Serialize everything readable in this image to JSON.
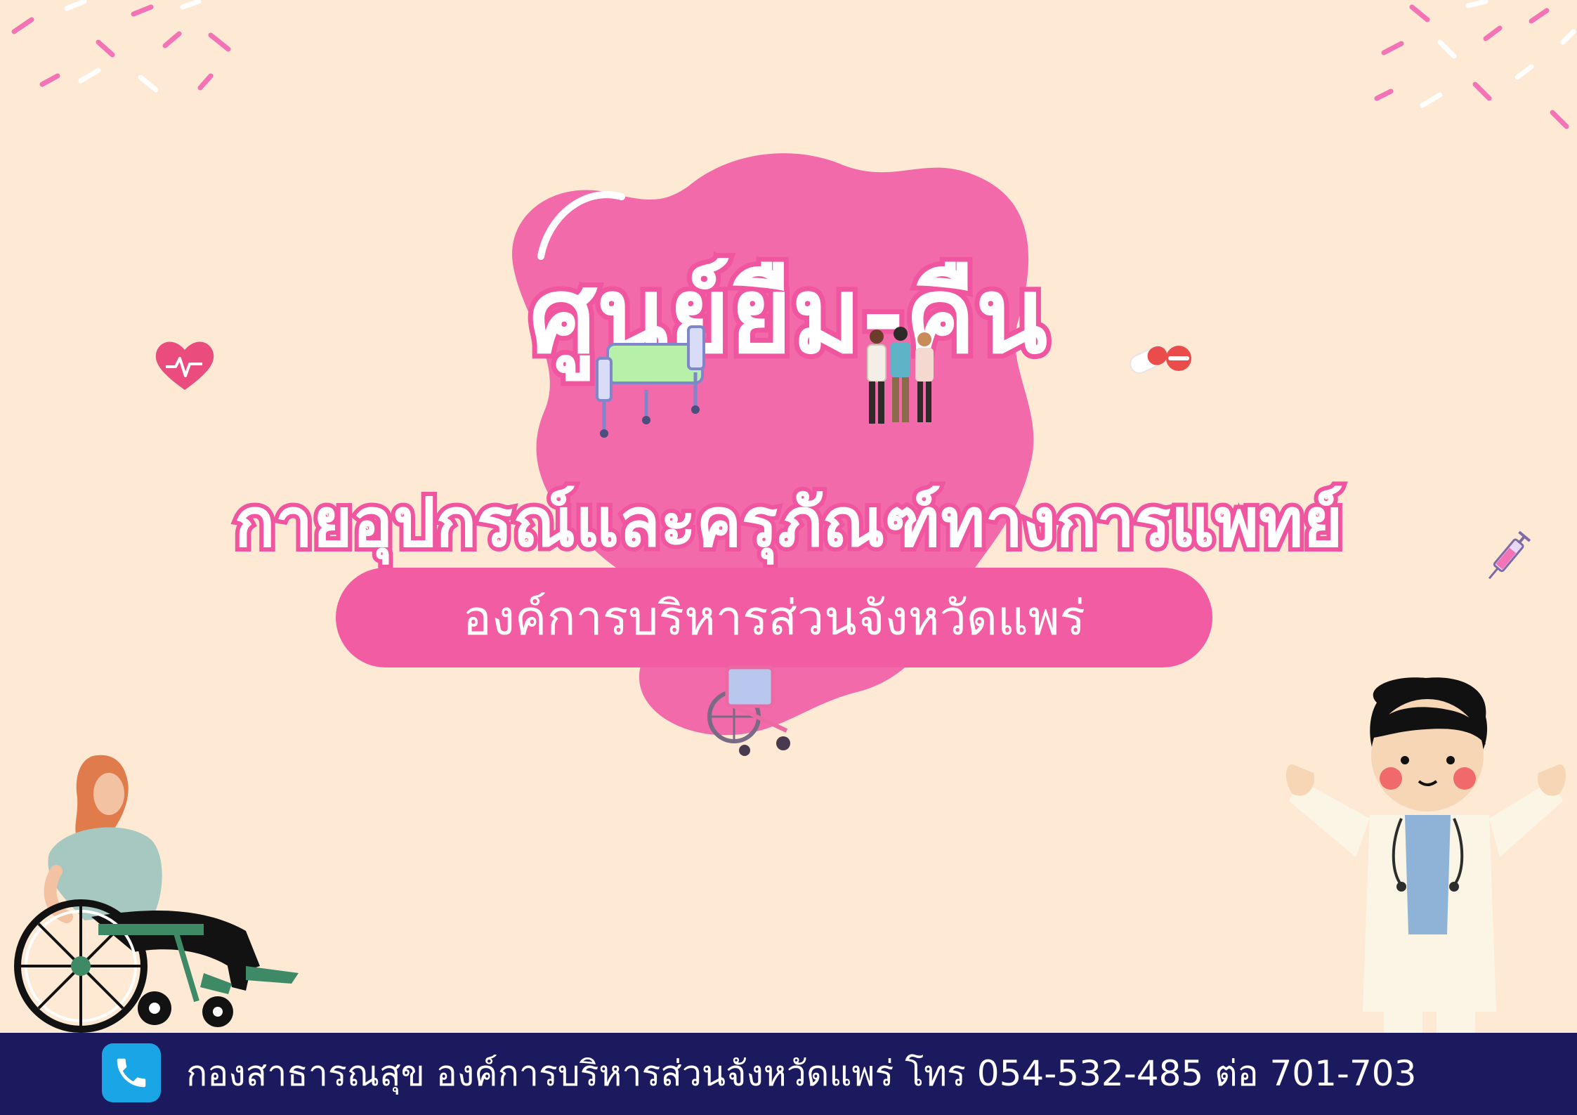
{
  "poster": {
    "title": "ศูนย์ยืม-คืน",
    "subtitle": "กายอุปกรณ์และครุภัณฑ์ทางการแพทย์",
    "organization": "องค์การบริหารส่วนจังหวัดแพร่",
    "contact": "กองสาธารณสุข องค์การบริหารส่วนจังหวัดแพร่ โทร 054-532-485 ต่อ 701-703"
  },
  "colors": {
    "background": "#fde9d4",
    "accent_pink": "#f25ca2",
    "footer_navy": "#1b1a5e",
    "phone_blue": "#1aa6e6"
  },
  "icons": [
    "heart-pulse-icon",
    "hospital-bed-icon",
    "medical-team-icon",
    "pill-capsule-icon",
    "syringe-icon",
    "wheelchair-icon",
    "phone-icon"
  ],
  "illustrations": [
    "woman-in-wheelchair-illustration",
    "doctor-illustration"
  ]
}
